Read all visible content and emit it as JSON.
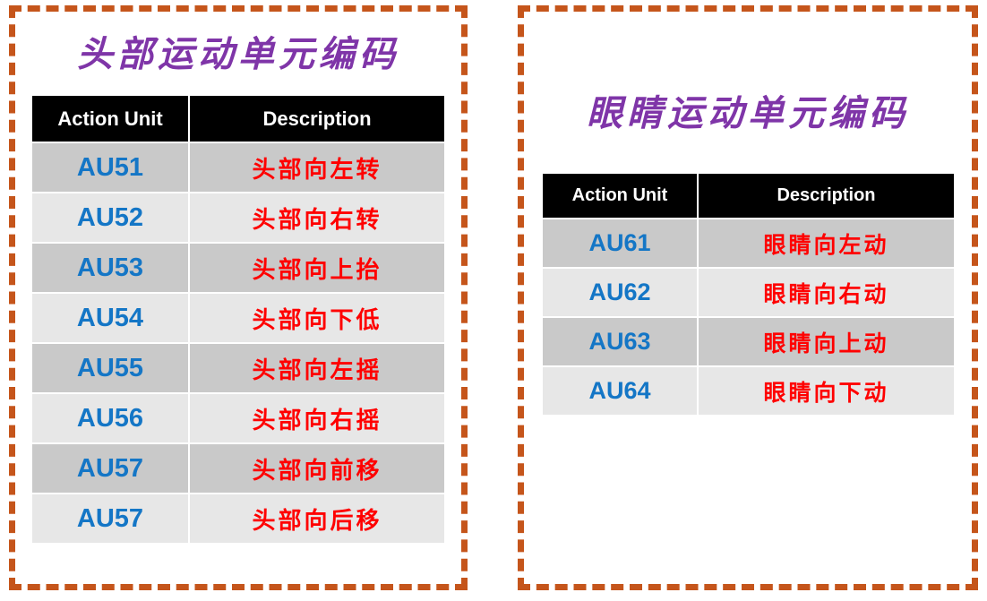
{
  "theme": {
    "border_color": "#C5551B",
    "title_color": "#7F35A8",
    "header_bg": "#000000",
    "header_fg": "#FFFFFF",
    "code_color": "#1476C6",
    "desc_color": "#FF0000",
    "row_dark_bg": "#C9C9C9",
    "row_light_bg": "#E7E7E7",
    "page_bg": "#FFFFFF"
  },
  "panels": {
    "head": {
      "title": "头部运动单元编码",
      "columns": {
        "code": "Action Unit",
        "description": "Description"
      },
      "rows": [
        {
          "code": "AU51",
          "description": "头部向左转"
        },
        {
          "code": "AU52",
          "description": "头部向右转"
        },
        {
          "code": "AU53",
          "description": "头部向上抬"
        },
        {
          "code": "AU54",
          "description": "头部向下低"
        },
        {
          "code": "AU55",
          "description": "头部向左摇"
        },
        {
          "code": "AU56",
          "description": "头部向右摇"
        },
        {
          "code": "AU57",
          "description": "头部向前移"
        },
        {
          "code": "AU57",
          "description": "头部向后移"
        }
      ]
    },
    "eye": {
      "title": "眼睛运动单元编码",
      "columns": {
        "code": "Action Unit",
        "description": "Description"
      },
      "rows": [
        {
          "code": "AU61",
          "description": "眼睛向左动"
        },
        {
          "code": "AU62",
          "description": "眼睛向右动"
        },
        {
          "code": "AU63",
          "description": "眼睛向上动"
        },
        {
          "code": "AU64",
          "description": "眼睛向下动"
        }
      ]
    }
  }
}
